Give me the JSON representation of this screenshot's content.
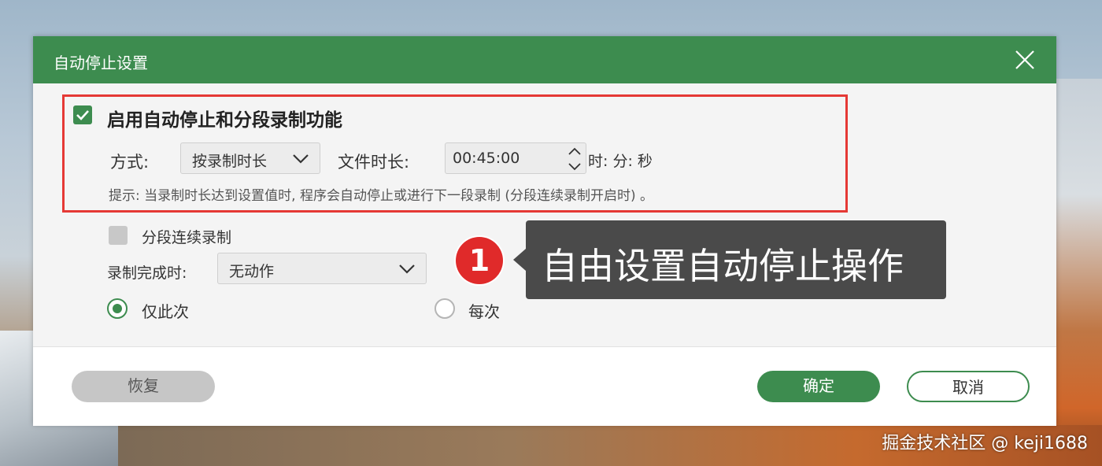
{
  "dialog": {
    "title": "自动停止设置"
  },
  "auto_stop": {
    "enable_label": "启用自动停止和分段录制功能",
    "enabled": true,
    "mode_label": "方式:",
    "mode_value": "按录制时长",
    "duration_label": "文件时长:",
    "duration_value": "00:45:00",
    "duration_unit": "时: 分: 秒",
    "hint": "提示: 当录制时长达到设置值时, 程序会自动停止或进行下一段录制 (分段连续录制开启时) 。"
  },
  "segment": {
    "label": "分段连续录制",
    "checked": false
  },
  "completion": {
    "label": "录制完成时:",
    "value": "无动作"
  },
  "frequency": {
    "once_label": "仅此次",
    "every_label": "每次",
    "selected": "once"
  },
  "footer": {
    "restore_label": "恢复",
    "ok_label": "确定",
    "cancel_label": "取消"
  },
  "annotation": {
    "badge_number": "1",
    "callout_text": "自由设置自动停止操作"
  },
  "watermark": "掘金技术社区 @ keji1688",
  "colors": {
    "accent": "#3d8c4f",
    "highlight": "#e53935",
    "badge": "#e02a2a",
    "callout_bg": "#4a4a4a"
  },
  "icons": {
    "close": "close-icon",
    "dropdown": "chevron-down-icon",
    "spinner": "spinner-arrows-icon",
    "check": "check-icon"
  }
}
